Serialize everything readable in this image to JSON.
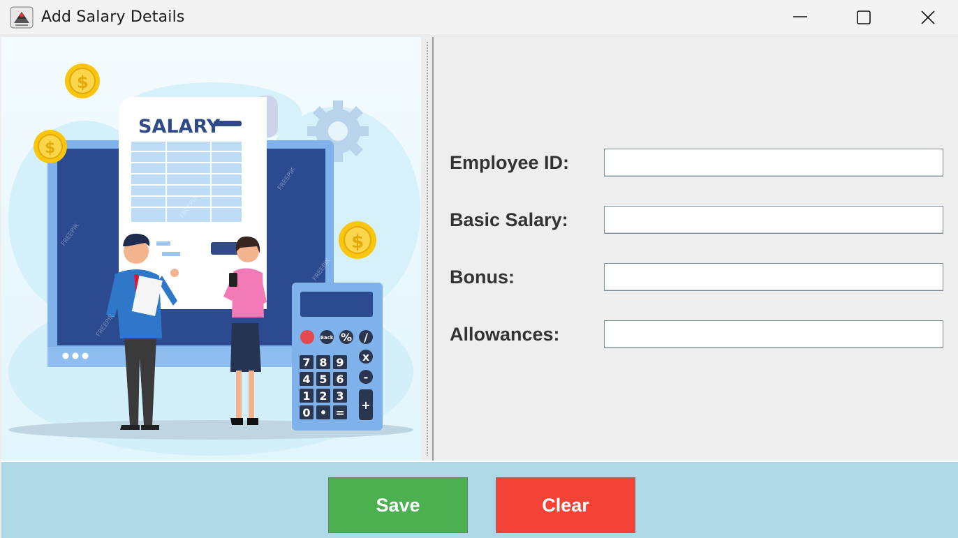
{
  "window": {
    "title": "Add Salary Details",
    "icon": "java-app-icon",
    "controls": [
      "minimize-icon",
      "maximize-icon",
      "close-icon"
    ]
  },
  "illustration": {
    "document_title": "SALARY",
    "calculator_keys": [
      "Back",
      "%",
      "/",
      "x",
      "-",
      "+",
      "7",
      "8",
      "9",
      "4",
      "5",
      "6",
      "1",
      "2",
      "3",
      "0",
      "•",
      "="
    ]
  },
  "form": {
    "fields": [
      {
        "label": "Employee ID:",
        "value": ""
      },
      {
        "label": "Basic Salary:",
        "value": ""
      },
      {
        "label": "Bonus:",
        "value": ""
      },
      {
        "label": "Allowances:",
        "value": ""
      }
    ]
  },
  "actions": {
    "save_label": "Save",
    "clear_label": "Clear"
  },
  "colors": {
    "save": "#4caf50",
    "clear": "#f44336",
    "footer": "#add8e6",
    "label": "#333333"
  }
}
